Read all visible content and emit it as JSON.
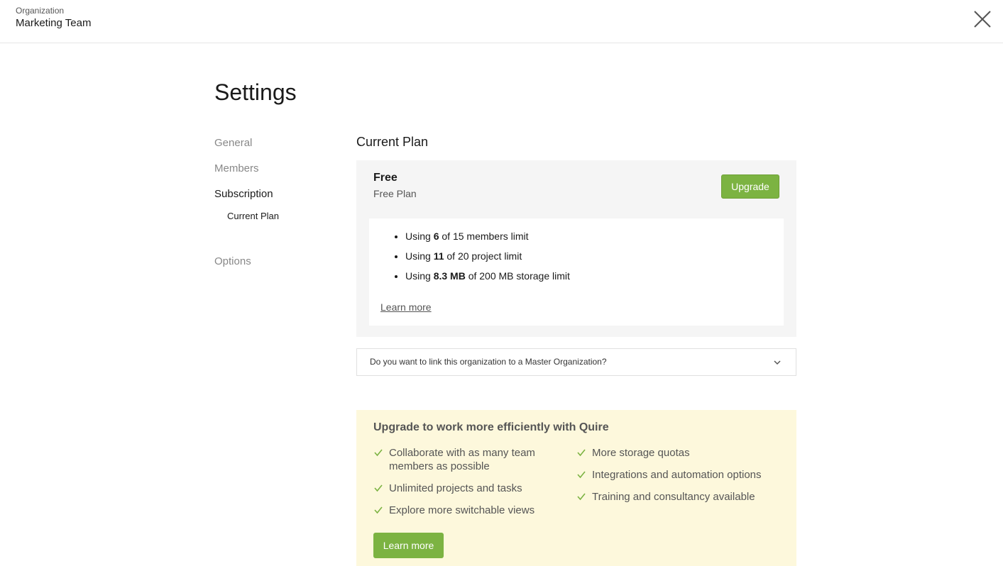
{
  "header": {
    "org_label": "Organization",
    "org_name": "Marketing Team"
  },
  "page": {
    "title": "Settings"
  },
  "nav": {
    "general": "General",
    "members": "Members",
    "subscription": "Subscription",
    "current_plan": "Current Plan",
    "options": "Options"
  },
  "plan": {
    "section_title": "Current Plan",
    "name": "Free",
    "description": "Free Plan",
    "upgrade_label": "Upgrade",
    "usage": [
      {
        "prefix": "Using ",
        "value": "6",
        "suffix": " of 15 members limit"
      },
      {
        "prefix": "Using ",
        "value": "11",
        "suffix": " of 20 project limit"
      },
      {
        "prefix": "Using ",
        "value": "8.3 MB",
        "suffix": " of 200 MB storage limit"
      }
    ],
    "learn_more": "Learn more"
  },
  "accordion": {
    "question": "Do you want to link this organization to a Master Organization?"
  },
  "promo": {
    "title": "Upgrade to work more efficiently with Quire",
    "features_left": [
      "Collaborate with as many team members as possible",
      "Unlimited projects and tasks",
      "Explore more switchable views"
    ],
    "features_right": [
      "More storage quotas",
      "Integrations and automation options",
      "Training and consultancy available"
    ],
    "button_label": "Learn more"
  },
  "colors": {
    "accent_green": "#7cb342",
    "promo_background": "#fdf8dc",
    "plan_background": "#f5f5f5"
  }
}
